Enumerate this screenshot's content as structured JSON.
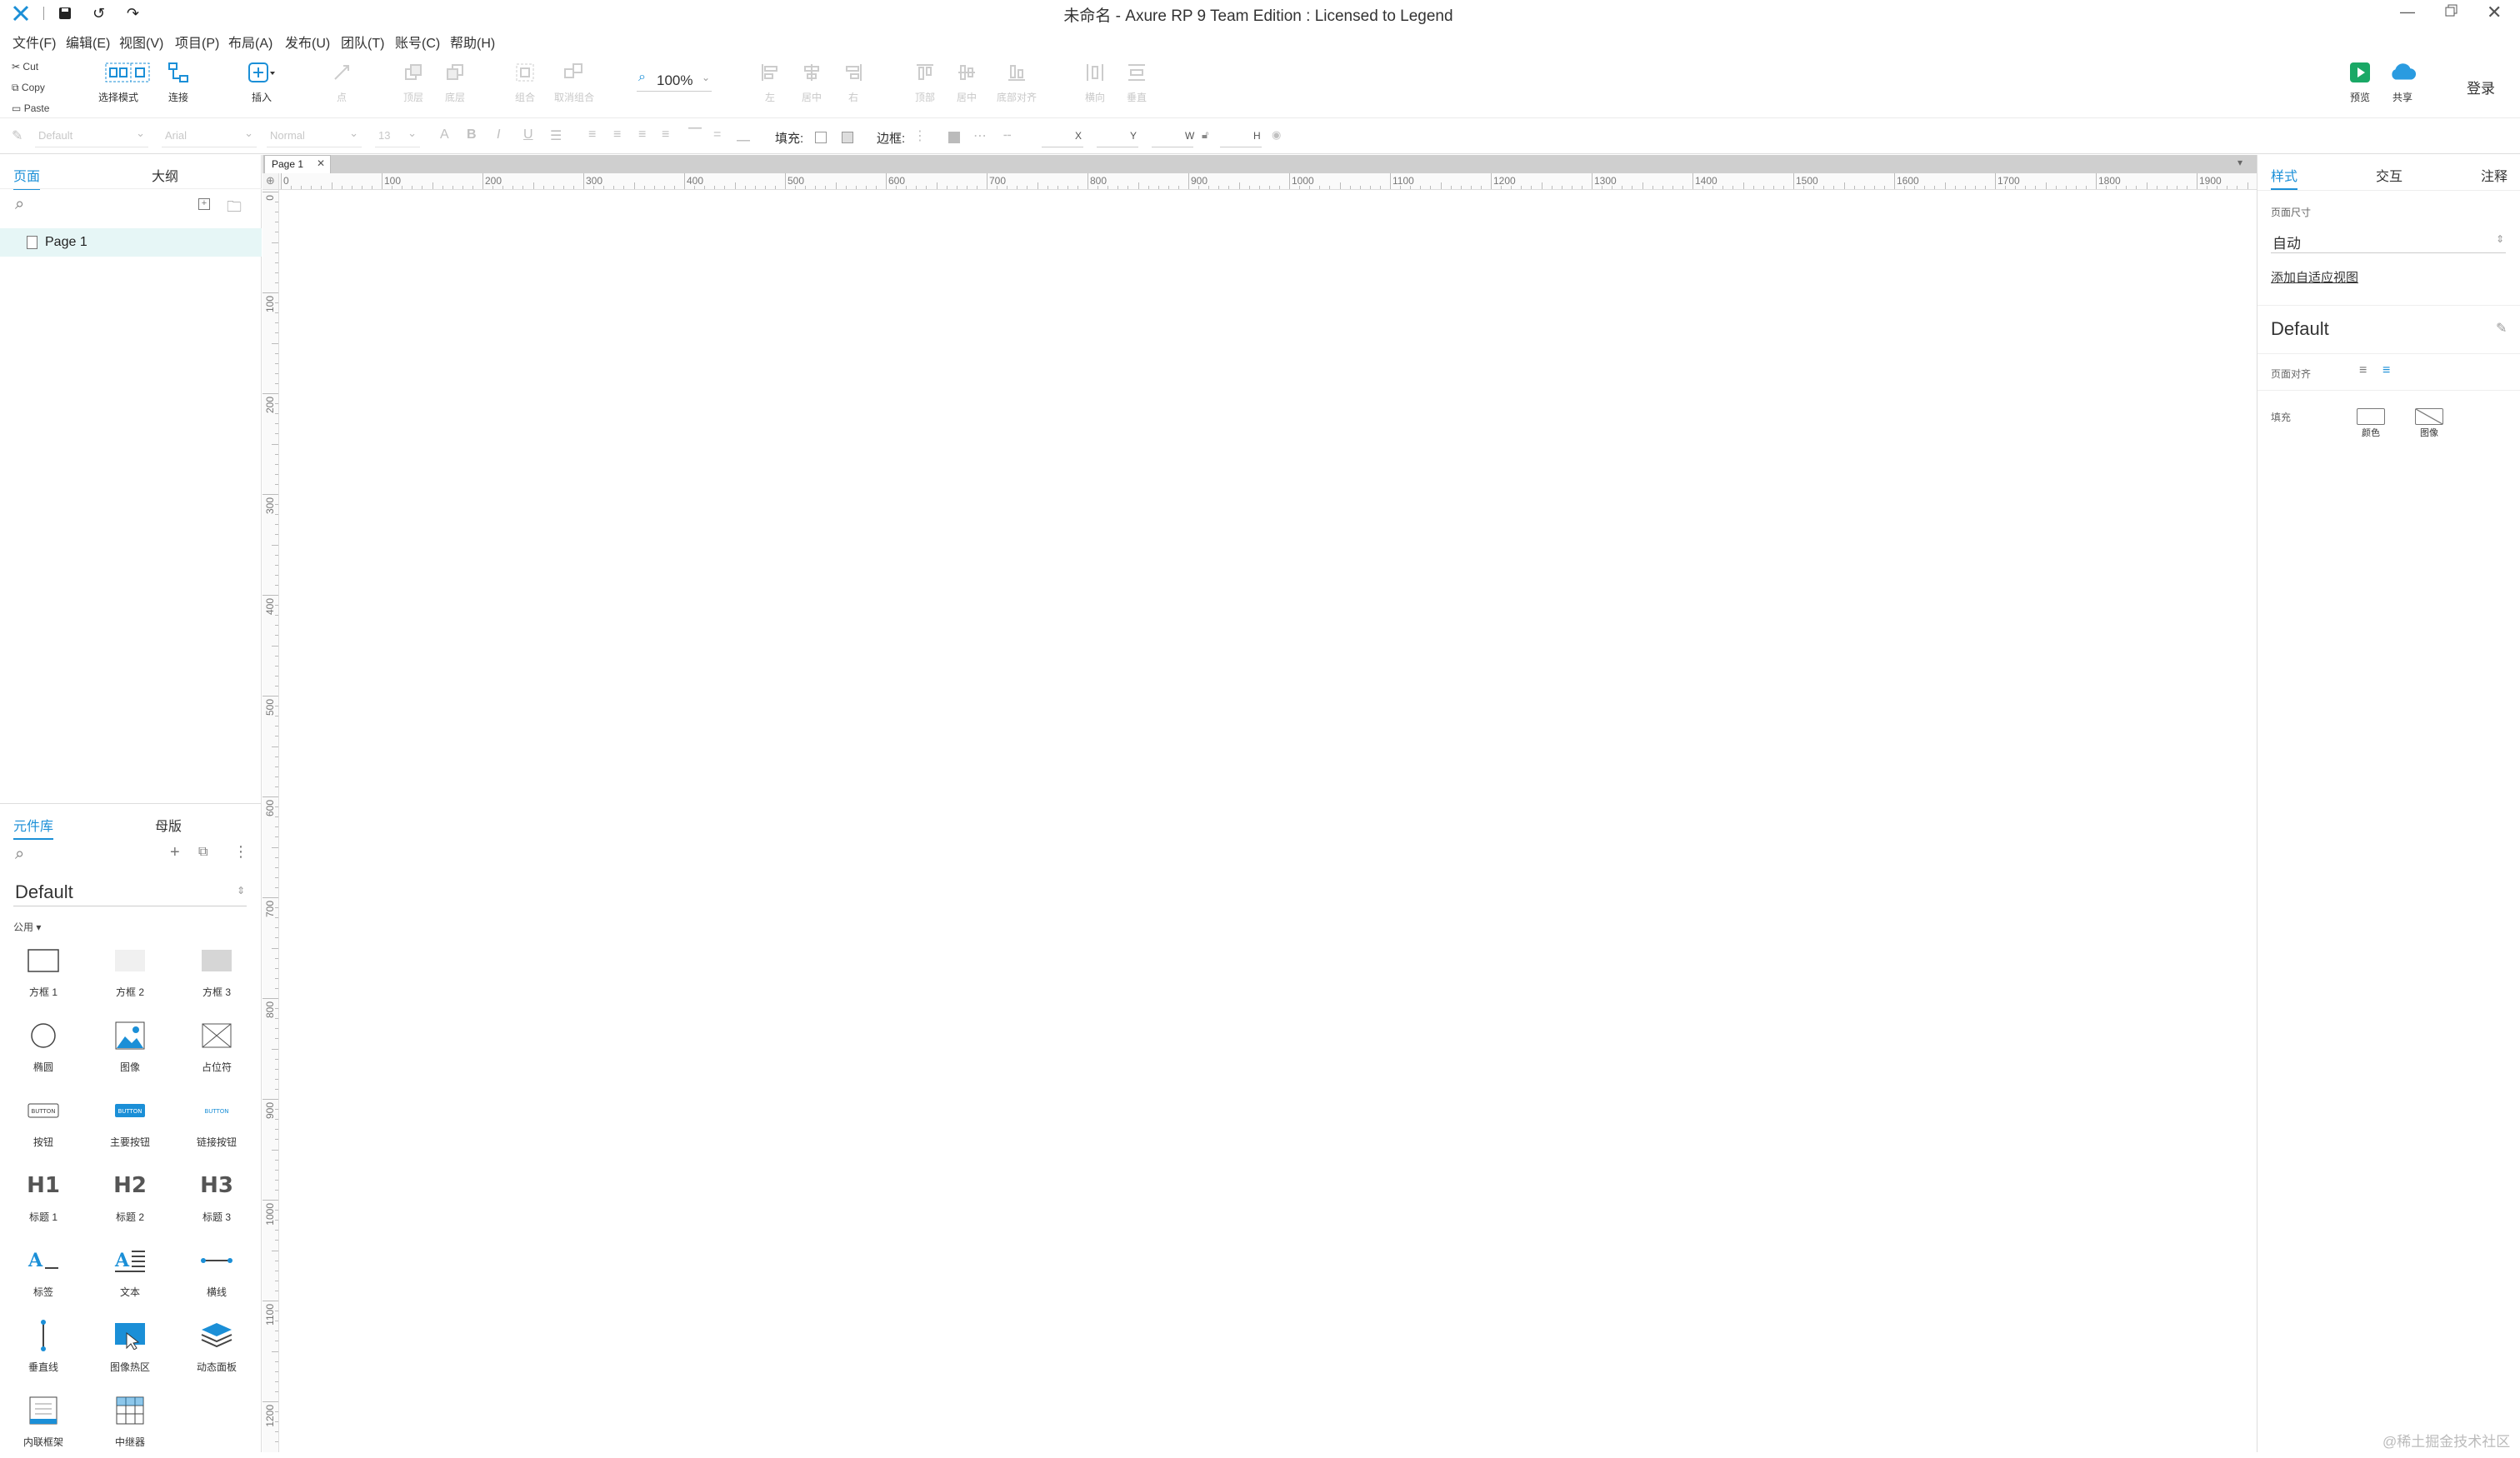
{
  "window": {
    "title": "未命名 - Axure RP 9 Team Edition : Licensed to Legend"
  },
  "menu": [
    "文件(F)",
    "编辑(E)",
    "视图(V)",
    "项目(P)",
    "布局(A)",
    "发布(U)",
    "团队(T)",
    "账号(C)",
    "帮助(H)"
  ],
  "clipboard": {
    "cut": "Cut",
    "copy": "Copy",
    "paste": "Paste"
  },
  "toolbar": {
    "select_mode": "选择模式",
    "connect": "连接",
    "insert": "插入",
    "point": "点",
    "top": "顶层",
    "bottom": "底层",
    "group": "组合",
    "ungroup": "取消组合",
    "zoom": "100%",
    "left": "左",
    "center": "居中",
    "right": "右",
    "top_align": "顶部",
    "middle": "居中",
    "bottom_align": "底部对齐",
    "horizontal": "横向",
    "vertical": "垂直",
    "preview": "预览",
    "share": "共享",
    "login": "登录"
  },
  "format": {
    "style": "Default",
    "font": "Arial",
    "weight": "Normal",
    "size": "13",
    "fill_label": "填充:",
    "border_label": "边框:",
    "x_label": "X",
    "y_label": "Y",
    "w_label": "W",
    "h_label": "H"
  },
  "pages_panel": {
    "tab_pages": "页面",
    "tab_outline": "大纲",
    "pages": [
      "Page 1"
    ]
  },
  "library_panel": {
    "tab_library": "元件库",
    "tab_masters": "母版",
    "library_name": "Default",
    "section": "公用 ▾",
    "widgets": [
      {
        "label": "方框 1",
        "icon": "box1-icon"
      },
      {
        "label": "方框 2",
        "icon": "box2-icon"
      },
      {
        "label": "方框 3",
        "icon": "box3-icon"
      },
      {
        "label": "椭圆",
        "icon": "ellipse-icon"
      },
      {
        "label": "图像",
        "icon": "image-icon"
      },
      {
        "label": "占位符",
        "icon": "placeholder-icon"
      },
      {
        "label": "按钮",
        "icon": "button-icon",
        "glyph": "BUTTON"
      },
      {
        "label": "主要按钮",
        "icon": "primary-button-icon",
        "glyph": "BUTTON"
      },
      {
        "label": "链接按钮",
        "icon": "link-button-icon",
        "glyph": "BUTTON"
      },
      {
        "label": "标题 1",
        "icon": "heading1-icon",
        "glyph": "H1"
      },
      {
        "label": "标题 2",
        "icon": "heading2-icon",
        "glyph": "H2"
      },
      {
        "label": "标题 3",
        "icon": "heading3-icon",
        "glyph": "H3"
      },
      {
        "label": "标签",
        "icon": "label-icon"
      },
      {
        "label": "文本",
        "icon": "text-icon"
      },
      {
        "label": "横线",
        "icon": "hline-icon"
      },
      {
        "label": "垂直线",
        "icon": "vline-icon"
      },
      {
        "label": "图像热区",
        "icon": "hotspot-icon"
      },
      {
        "label": "动态面板",
        "icon": "dynamic-panel-icon"
      },
      {
        "label": "内联框架",
        "icon": "inline-frame-icon"
      },
      {
        "label": "中继器",
        "icon": "repeater-icon"
      }
    ]
  },
  "canvas": {
    "tab": "Page 1",
    "ruler_h": [
      "0",
      "100",
      "200",
      "300",
      "400",
      "500",
      "600",
      "700",
      "800",
      "900",
      "1000",
      "1100",
      "1200",
      "1300",
      "1400",
      "1500",
      "1600",
      "1700",
      "1800",
      "1900"
    ],
    "ruler_v": [
      "0",
      "100",
      "200",
      "300",
      "400",
      "500",
      "600",
      "700",
      "800",
      "900",
      "1000",
      "1100",
      "1200"
    ]
  },
  "right_panel": {
    "tab_style": "样式",
    "tab_interact": "交互",
    "tab_notes": "注释",
    "page_size_label": "页面尺寸",
    "page_size_value": "自动",
    "adaptive_link": "添加自适应视图",
    "style_name": "Default",
    "page_align_label": "页面对齐",
    "fill_label": "填充",
    "fill_color": "颜色",
    "fill_image": "图像"
  },
  "watermark": "@稀土掘金技术社区",
  "colors": {
    "accent": "#1b8fd7",
    "preview": "#1aa866",
    "share": "#2a9be0"
  }
}
